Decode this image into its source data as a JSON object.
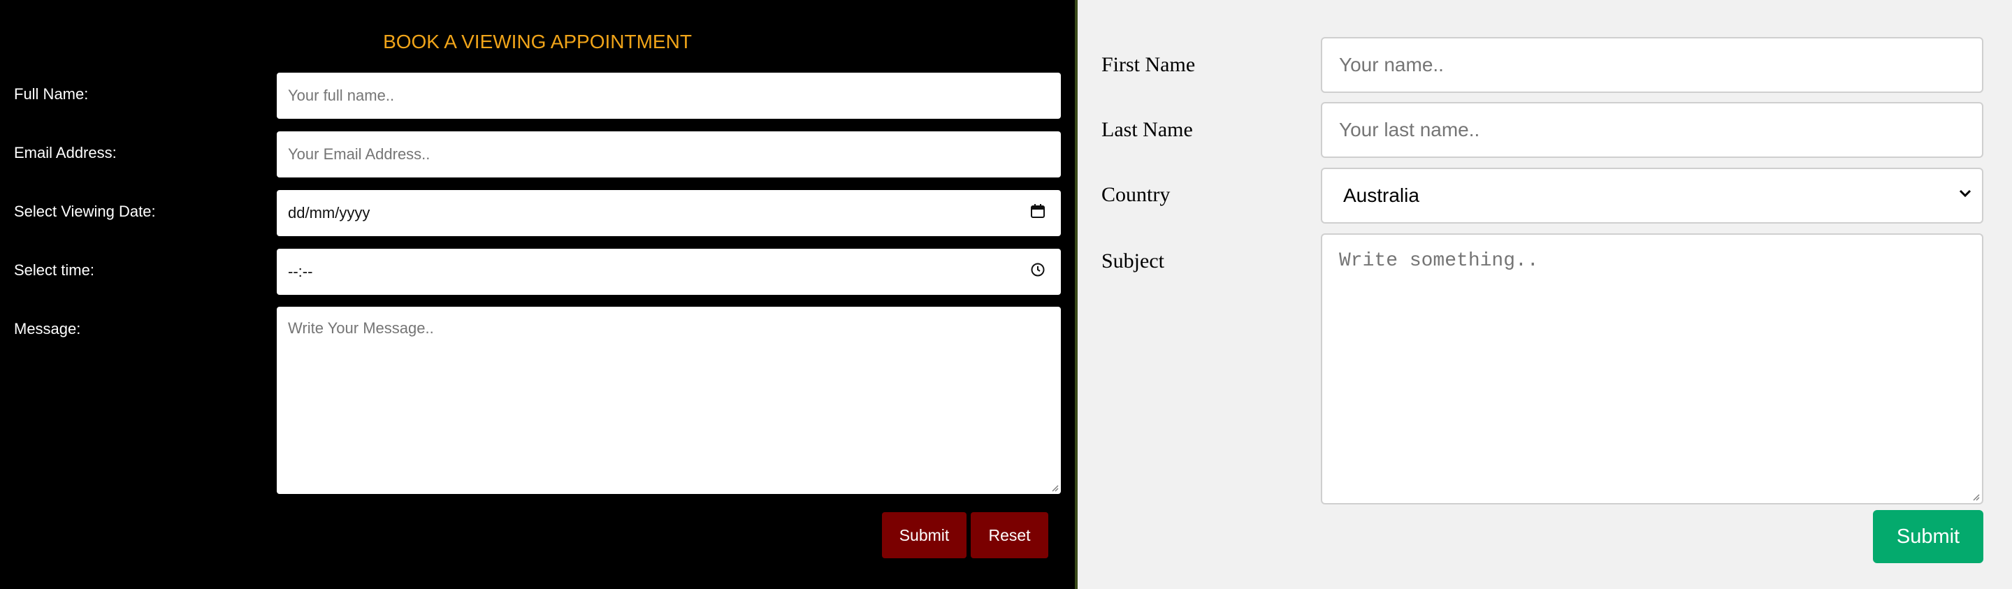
{
  "booking_form": {
    "title": "BOOK A VIEWING APPOINTMENT",
    "labels": {
      "full_name": "Full Name:",
      "email": "Email Address:",
      "date": "Select Viewing Date:",
      "time": "Select time:",
      "message": "Message:"
    },
    "placeholders": {
      "full_name": "Your full name..",
      "email": "Your Email Address..",
      "message": "Write Your Message.."
    },
    "values": {
      "date": "dd/mm/yyyy",
      "time": "--:--"
    },
    "buttons": {
      "submit": "Submit",
      "reset": "Reset"
    },
    "colors": {
      "background": "#000000",
      "title": "#f0a419",
      "button": "#7a0000"
    }
  },
  "contact_form": {
    "labels": {
      "first_name": "First Name",
      "last_name": "Last Name",
      "country": "Country",
      "subject": "Subject"
    },
    "placeholders": {
      "first_name": "Your name..",
      "last_name": "Your last name..",
      "subject": "Write something.."
    },
    "country_selected": "Australia",
    "submit": "Submit",
    "colors": {
      "background": "#f1f1f1",
      "submit": "#04aa6d"
    }
  },
  "icons": [
    "calendar-icon",
    "clock-icon",
    "chevron-down-icon",
    "resize-grip-icon"
  ]
}
